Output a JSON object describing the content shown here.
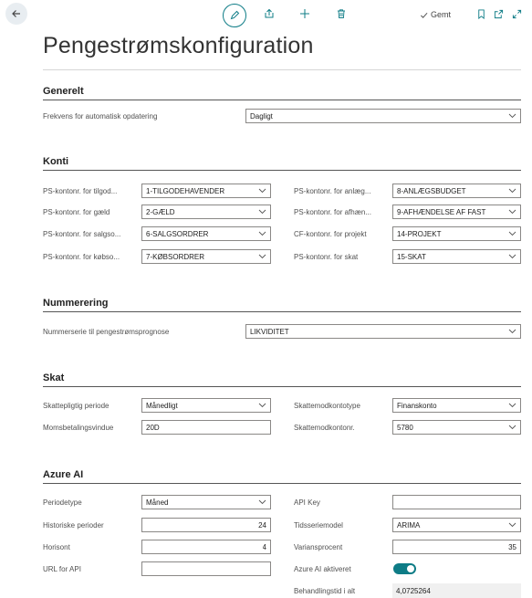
{
  "page": {
    "title": "Pengestrømskonfiguration"
  },
  "toolbar": {
    "saved_label": "Gemt"
  },
  "generelt": {
    "title": "Generelt",
    "frequency_label": "Frekvens for automatisk opdatering",
    "frequency_value": "Dagligt"
  },
  "konti": {
    "title": "Konti",
    "left": [
      {
        "label": "PS-kontonr. for tilgod...",
        "value": "1-TILGODEHAVENDER"
      },
      {
        "label": "PS-kontonr. for gæld",
        "value": "2-GÆLD"
      },
      {
        "label": "PS-kontonr. for salgso...",
        "value": "6-SALGSORDRER"
      },
      {
        "label": "PS-kontonr. for købso...",
        "value": "7-KØBSORDRER"
      }
    ],
    "right": [
      {
        "label": "PS-kontonr. for anlæg...",
        "value": "8-ANLÆGSBUDGET"
      },
      {
        "label": "PS-kontonr. for afhæn...",
        "value": "9-AFHÆNDELSE AF FAST"
      },
      {
        "label": "CF-kontonr. for projekt",
        "value": "14-PROJEKT"
      },
      {
        "label": "PS-kontonr. for skat",
        "value": "15-SKAT"
      }
    ]
  },
  "nummerering": {
    "title": "Nummerering",
    "series_label": "Nummerserie til pengestrømsprognose",
    "series_value": "LIKVIDITET"
  },
  "skat": {
    "title": "Skat",
    "period_label": "Skattepligtig periode",
    "period_value": "Månedligt",
    "window_label": "Momsbetalingsvindue",
    "window_value": "20D",
    "modtype_label": "Skattemodkontotype",
    "modtype_value": "Finanskonto",
    "modno_label": "Skattemodkontonr.",
    "modno_value": "5780"
  },
  "azure": {
    "title": "Azure AI",
    "periodtype_label": "Periodetype",
    "periodtype_value": "Måned",
    "hist_label": "Historiske perioder",
    "hist_value": "24",
    "horizon_label": "Horisont",
    "horizon_value": "4",
    "url_label": "URL for API",
    "url_value": "",
    "apikey_label": "API Key",
    "apikey_value": "",
    "model_label": "Tidsseriemodel",
    "model_value": "ARIMA",
    "variance_label": "Variansprocent",
    "variance_value": "35",
    "enabled_label": "Azure AI aktiveret",
    "enabled": true,
    "time_label": "Behandlingstid i alt",
    "time_value": "4,0725264"
  },
  "colors": {
    "accent": "#0e7c86",
    "border": "#8a8886"
  }
}
